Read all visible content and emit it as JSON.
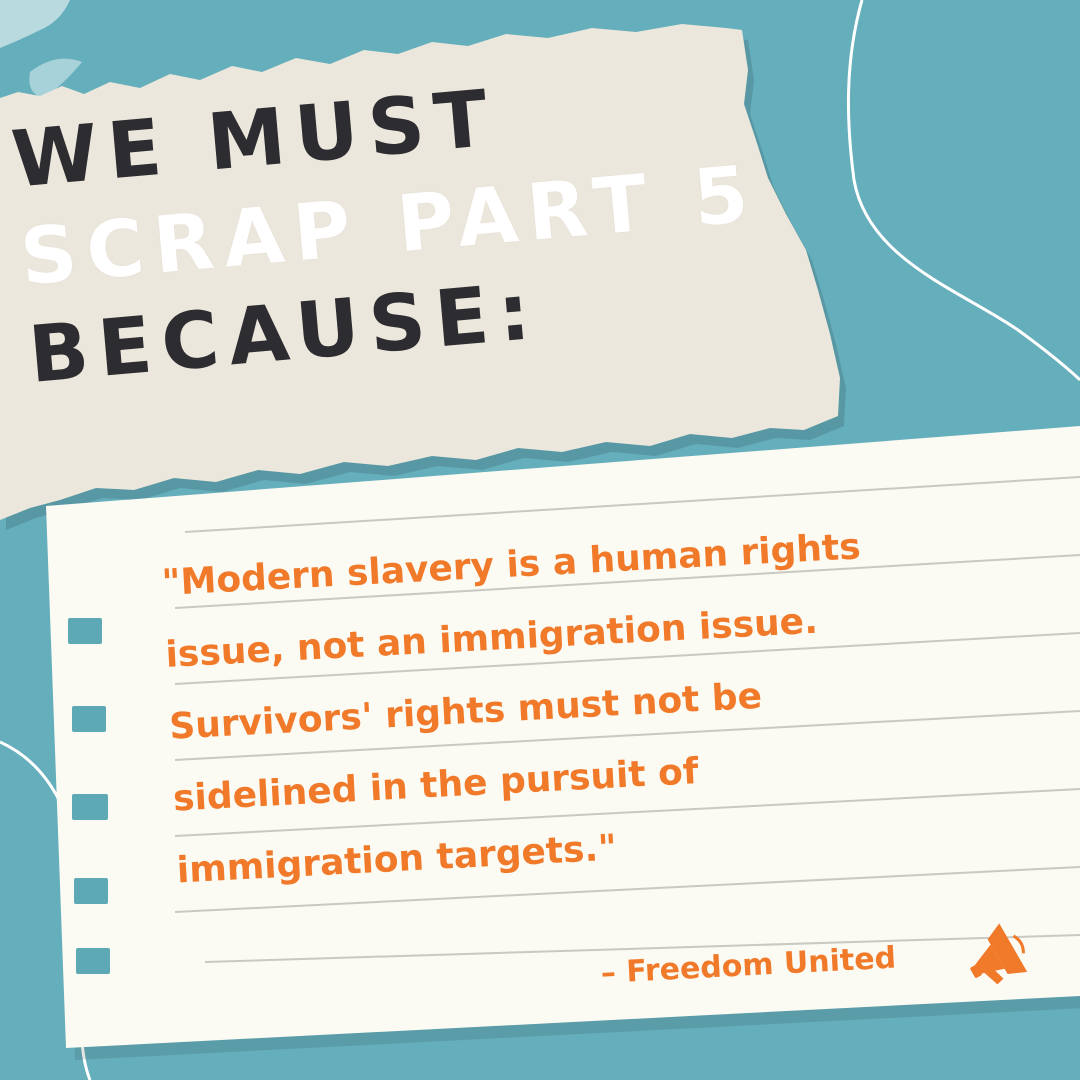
{
  "headline": {
    "line1": "We must",
    "line2": "Scrap Part 5",
    "line3": "because:"
  },
  "quote": {
    "lines": [
      "\"Modern slavery is a human rights",
      "issue, not an immigration issue.",
      "Survivors' rights must not be",
      "sidelined in the pursuit of",
      "immigration targets.\""
    ]
  },
  "attribution": "– Freedom United",
  "icons": {
    "attribution_icon": "megaphone-icon"
  },
  "colors": {
    "background": "#65aebb",
    "torn_paper": "#ece7dc",
    "notebook_paper": "#fbfaf3",
    "headline_dark": "#2d2c30",
    "headline_light": "#ffffff",
    "quote_text": "#f07a2a",
    "rule_lines": "#c9c9c4"
  }
}
